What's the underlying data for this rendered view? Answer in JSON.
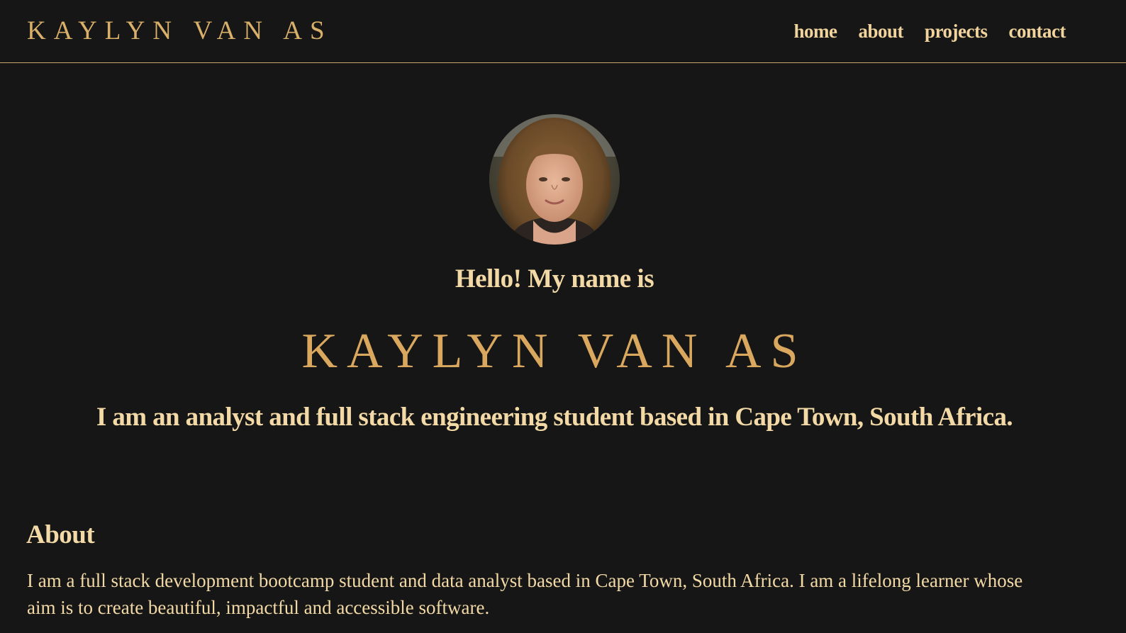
{
  "header": {
    "logo": "KAYLYN VAN AS",
    "nav": {
      "home": "home",
      "about": "about",
      "projects": "projects",
      "contact": "contact"
    }
  },
  "hero": {
    "greeting": "Hello! My name is",
    "name": "KAYLYN VAN AS",
    "tagline": "I am an analyst and full stack engineering student based in Cape Town, South Africa."
  },
  "about": {
    "heading": "About",
    "text": "I am a full stack development bootcamp student and data analyst based in Cape Town, South Africa. I am a lifelong learner whose aim is to create beautiful, impactful and accessible software."
  },
  "colors": {
    "background": "#161616",
    "accent_gold": "#d9a85e",
    "text_cream": "#f2d9a6",
    "divider": "#c9a86a"
  }
}
